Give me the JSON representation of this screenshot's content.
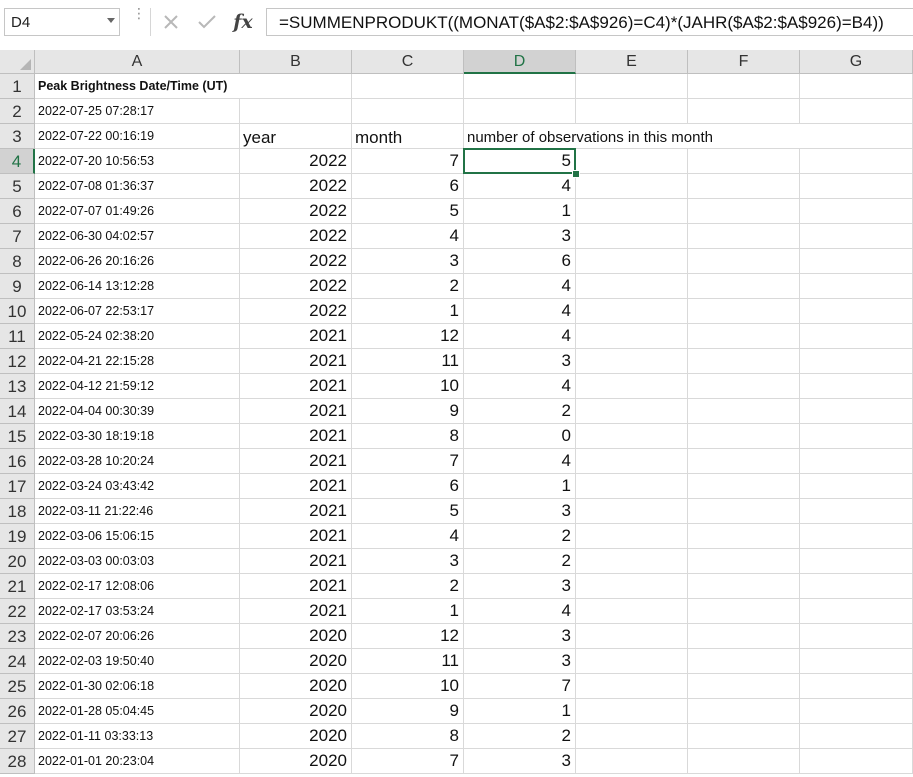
{
  "name_box": {
    "value": "D4"
  },
  "formula_bar": {
    "formula": "=SUMMENPRODUKT((MONAT($A$2:$A$926)=C4)*(JAHR($A$2:$A$926)=B4))",
    "fx_label": "fx",
    "icons": [
      "more-dots-icon",
      "cancel-x-icon",
      "enter-check-icon",
      "insert-function-icon"
    ]
  },
  "columns": [
    "A",
    "B",
    "C",
    "D",
    "E",
    "F",
    "G"
  ],
  "selected_column": "D",
  "selected_row": 4,
  "header_row": {
    "a1": "Peak Brightness Date/Time (UT)",
    "b3": "year",
    "c3": "month",
    "d3": "number of observations in this month"
  },
  "rows": [
    {
      "row": "1",
      "a": "Peak Brightness Date/Time (UT)"
    },
    {
      "row": "2",
      "a": "2022-07-25 07:28:17"
    },
    {
      "row": "3",
      "a": "2022-07-22 00:16:19"
    },
    {
      "row": "4",
      "a": "2022-07-20 10:56:53",
      "b": "2022",
      "c": "7",
      "d": "5"
    },
    {
      "row": "5",
      "a": "2022-07-08 01:36:37",
      "b": "2022",
      "c": "6",
      "d": "4"
    },
    {
      "row": "6",
      "a": "2022-07-07 01:49:26",
      "b": "2022",
      "c": "5",
      "d": "1"
    },
    {
      "row": "7",
      "a": "2022-06-30 04:02:57",
      "b": "2022",
      "c": "4",
      "d": "3"
    },
    {
      "row": "8",
      "a": "2022-06-26 20:16:26",
      "b": "2022",
      "c": "3",
      "d": "6"
    },
    {
      "row": "9",
      "a": "2022-06-14 13:12:28",
      "b": "2022",
      "c": "2",
      "d": "4"
    },
    {
      "row": "10",
      "a": "2022-06-07 22:53:17",
      "b": "2022",
      "c": "1",
      "d": "4"
    },
    {
      "row": "11",
      "a": "2022-05-24 02:38:20",
      "b": "2021",
      "c": "12",
      "d": "4"
    },
    {
      "row": "12",
      "a": "2022-04-21 22:15:28",
      "b": "2021",
      "c": "11",
      "d": "3"
    },
    {
      "row": "13",
      "a": "2022-04-12 21:59:12",
      "b": "2021",
      "c": "10",
      "d": "4"
    },
    {
      "row": "14",
      "a": "2022-04-04 00:30:39",
      "b": "2021",
      "c": "9",
      "d": "2"
    },
    {
      "row": "15",
      "a": "2022-03-30 18:19:18",
      "b": "2021",
      "c": "8",
      "d": "0"
    },
    {
      "row": "16",
      "a": "2022-03-28 10:20:24",
      "b": "2021",
      "c": "7",
      "d": "4"
    },
    {
      "row": "17",
      "a": "2022-03-24 03:43:42",
      "b": "2021",
      "c": "6",
      "d": "1"
    },
    {
      "row": "18",
      "a": "2022-03-11 21:22:46",
      "b": "2021",
      "c": "5",
      "d": "3"
    },
    {
      "row": "19",
      "a": "2022-03-06 15:06:15",
      "b": "2021",
      "c": "4",
      "d": "2"
    },
    {
      "row": "20",
      "a": "2022-03-03 00:03:03",
      "b": "2021",
      "c": "3",
      "d": "2"
    },
    {
      "row": "21",
      "a": "2022-02-17 12:08:06",
      "b": "2021",
      "c": "2",
      "d": "3"
    },
    {
      "row": "22",
      "a": "2022-02-17 03:53:24",
      "b": "2021",
      "c": "1",
      "d": "4"
    },
    {
      "row": "23",
      "a": "2022-02-07 20:06:26",
      "b": "2020",
      "c": "12",
      "d": "3"
    },
    {
      "row": "24",
      "a": "2022-02-03 19:50:40",
      "b": "2020",
      "c": "11",
      "d": "3"
    },
    {
      "row": "25",
      "a": "2022-01-30 02:06:18",
      "b": "2020",
      "c": "10",
      "d": "7"
    },
    {
      "row": "26",
      "a": "2022-01-28 05:04:45",
      "b": "2020",
      "c": "9",
      "d": "1"
    },
    {
      "row": "27",
      "a": "2022-01-11 03:33:13",
      "b": "2020",
      "c": "8",
      "d": "2"
    },
    {
      "row": "28",
      "a": "2022-01-01 20:23:04",
      "b": "2020",
      "c": "7",
      "d": "3"
    }
  ],
  "colors": {
    "accent": "#217346",
    "header_bg": "#e6e6e6",
    "gridline": "#d9d9d9"
  }
}
